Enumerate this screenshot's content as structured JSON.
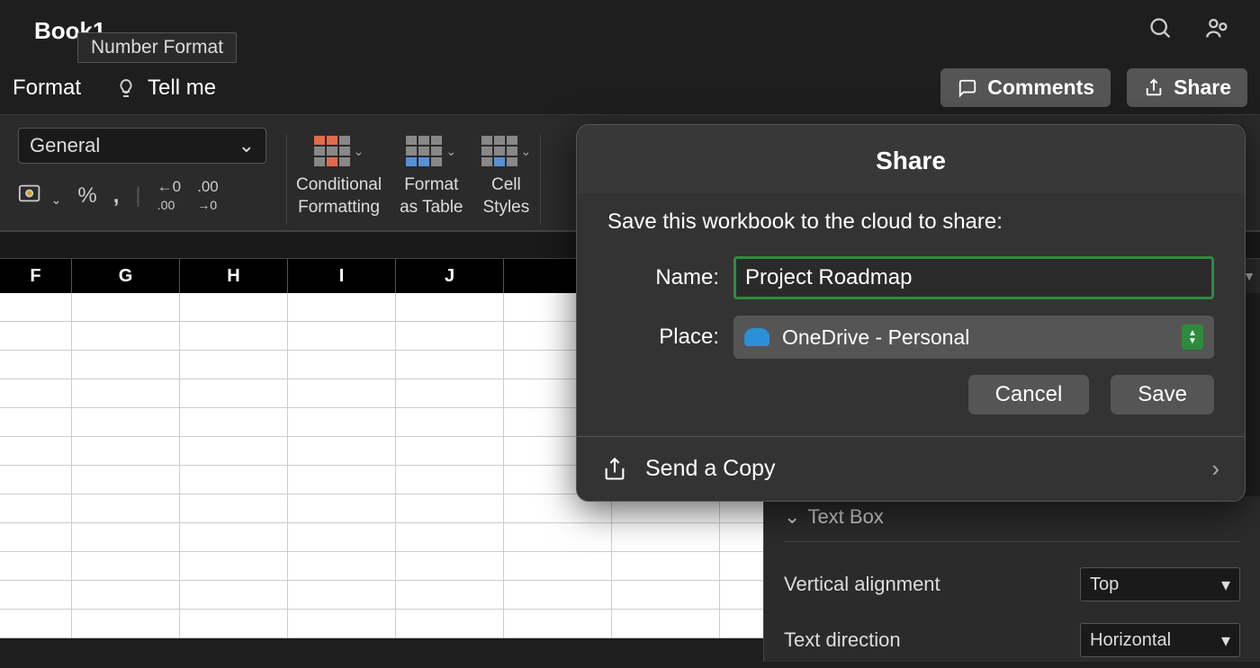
{
  "title": {
    "document": "Book1",
    "tooltip": "Number Format"
  },
  "menubar": {
    "format": "Format",
    "tell_me": "Tell me",
    "comments": "Comments",
    "share": "Share"
  },
  "ribbon": {
    "number_format_value": "General",
    "conditional_formatting_l1": "Conditional",
    "conditional_formatting_l2": "Formatting",
    "format_as_table_l1": "Format",
    "format_as_table_l2": "as Table",
    "cell_styles_l1": "Cell",
    "cell_styles_l2": "Styles"
  },
  "columns": [
    "F",
    "G",
    "H",
    "I",
    "J"
  ],
  "share_popover": {
    "title": "Share",
    "subtitle": "Save this workbook to the cloud to share:",
    "name_label": "Name:",
    "name_value": "Project Roadmap",
    "place_label": "Place:",
    "place_value": "OneDrive - Personal",
    "cancel": "Cancel",
    "save": "Save",
    "send_copy": "Send a Copy"
  },
  "side_panel": {
    "section": "Text Box",
    "vertical_alignment_label": "Vertical alignment",
    "vertical_alignment_value": "Top",
    "text_direction_label": "Text direction",
    "text_direction_value": "Horizontal"
  }
}
